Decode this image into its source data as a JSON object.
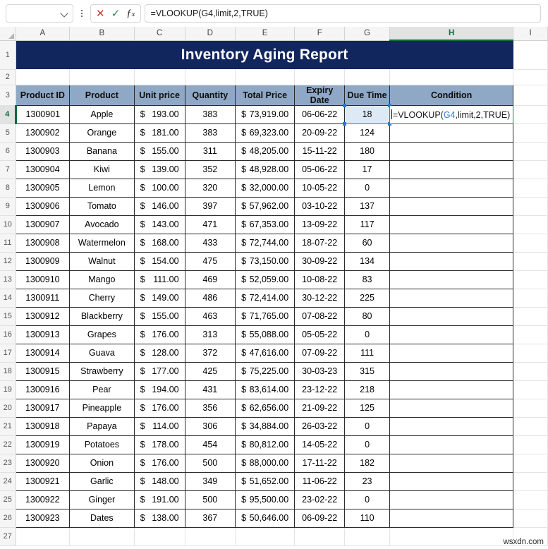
{
  "formula_bar": {
    "name_box_value": "",
    "name_box_placeholder": "",
    "cancel_icon": "cancel-x-icon",
    "confirm_icon": "confirm-check-icon",
    "function_icon": "insert-function-fx-icon",
    "formula_value": "=VLOOKUP(G4,limit,2,TRUE)"
  },
  "grid": {
    "column_headers": [
      "A",
      "B",
      "C",
      "D",
      "E",
      "F",
      "G",
      "H",
      "I"
    ],
    "selected_column": "H",
    "row_headers": [
      "1",
      "2",
      "3",
      "4",
      "5",
      "6",
      "7",
      "8",
      "9",
      "10",
      "11",
      "12",
      "13",
      "14",
      "15",
      "16",
      "17",
      "18",
      "19",
      "20",
      "21",
      "22",
      "23",
      "24",
      "25",
      "26",
      "27"
    ],
    "selected_row": "4"
  },
  "title": {
    "text": "Inventory Aging Report",
    "background": "#12265E",
    "color": "#FFFFFF",
    "range": "A1:H1"
  },
  "table": {
    "header_background": "#8FA8C6",
    "headers": [
      "Product ID",
      "Product",
      "Unit price",
      "Quantity",
      "Total Price",
      "Expiry Date",
      "Due Time",
      "Condition"
    ],
    "rows": [
      {
        "row": "4",
        "product_id": "1300901",
        "product": "Apple",
        "unit_price": "193.00",
        "quantity": "383",
        "total_price": "73,919.00",
        "expiry_date": "06-06-22",
        "due_time": "18",
        "condition": ""
      },
      {
        "row": "5",
        "product_id": "1300902",
        "product": "Orange",
        "unit_price": "181.00",
        "quantity": "383",
        "total_price": "69,323.00",
        "expiry_date": "20-09-22",
        "due_time": "124",
        "condition": ""
      },
      {
        "row": "6",
        "product_id": "1300903",
        "product": "Banana",
        "unit_price": "155.00",
        "quantity": "311",
        "total_price": "48,205.00",
        "expiry_date": "15-11-22",
        "due_time": "180",
        "condition": ""
      },
      {
        "row": "7",
        "product_id": "1300904",
        "product": "Kiwi",
        "unit_price": "139.00",
        "quantity": "352",
        "total_price": "48,928.00",
        "expiry_date": "05-06-22",
        "due_time": "17",
        "condition": ""
      },
      {
        "row": "8",
        "product_id": "1300905",
        "product": "Lemon",
        "unit_price": "100.00",
        "quantity": "320",
        "total_price": "32,000.00",
        "expiry_date": "10-05-22",
        "due_time": "0",
        "condition": ""
      },
      {
        "row": "9",
        "product_id": "1300906",
        "product": "Tomato",
        "unit_price": "146.00",
        "quantity": "397",
        "total_price": "57,962.00",
        "expiry_date": "03-10-22",
        "due_time": "137",
        "condition": ""
      },
      {
        "row": "10",
        "product_id": "1300907",
        "product": "Avocado",
        "unit_price": "143.00",
        "quantity": "471",
        "total_price": "67,353.00",
        "expiry_date": "13-09-22",
        "due_time": "117",
        "condition": ""
      },
      {
        "row": "11",
        "product_id": "1300908",
        "product": "Watermelon",
        "unit_price": "168.00",
        "quantity": "433",
        "total_price": "72,744.00",
        "expiry_date": "18-07-22",
        "due_time": "60",
        "condition": ""
      },
      {
        "row": "12",
        "product_id": "1300909",
        "product": "Walnut",
        "unit_price": "154.00",
        "quantity": "475",
        "total_price": "73,150.00",
        "expiry_date": "30-09-22",
        "due_time": "134",
        "condition": ""
      },
      {
        "row": "13",
        "product_id": "1300910",
        "product": "Mango",
        "unit_price": "111.00",
        "quantity": "469",
        "total_price": "52,059.00",
        "expiry_date": "10-08-22",
        "due_time": "83",
        "condition": ""
      },
      {
        "row": "14",
        "product_id": "1300911",
        "product": "Cherry",
        "unit_price": "149.00",
        "quantity": "486",
        "total_price": "72,414.00",
        "expiry_date": "30-12-22",
        "due_time": "225",
        "condition": ""
      },
      {
        "row": "15",
        "product_id": "1300912",
        "product": "Blackberry",
        "unit_price": "155.00",
        "quantity": "463",
        "total_price": "71,765.00",
        "expiry_date": "07-08-22",
        "due_time": "80",
        "condition": ""
      },
      {
        "row": "16",
        "product_id": "1300913",
        "product": "Grapes",
        "unit_price": "176.00",
        "quantity": "313",
        "total_price": "55,088.00",
        "expiry_date": "05-05-22",
        "due_time": "0",
        "condition": ""
      },
      {
        "row": "17",
        "product_id": "1300914",
        "product": "Guava",
        "unit_price": "128.00",
        "quantity": "372",
        "total_price": "47,616.00",
        "expiry_date": "07-09-22",
        "due_time": "111",
        "condition": ""
      },
      {
        "row": "18",
        "product_id": "1300915",
        "product": "Strawberry",
        "unit_price": "177.00",
        "quantity": "425",
        "total_price": "75,225.00",
        "expiry_date": "30-03-23",
        "due_time": "315",
        "condition": ""
      },
      {
        "row": "19",
        "product_id": "1300916",
        "product": "Pear",
        "unit_price": "194.00",
        "quantity": "431",
        "total_price": "83,614.00",
        "expiry_date": "23-12-22",
        "due_time": "218",
        "condition": ""
      },
      {
        "row": "20",
        "product_id": "1300917",
        "product": "Pineapple",
        "unit_price": "176.00",
        "quantity": "356",
        "total_price": "62,656.00",
        "expiry_date": "21-09-22",
        "due_time": "125",
        "condition": ""
      },
      {
        "row": "21",
        "product_id": "1300918",
        "product": "Papaya",
        "unit_price": "114.00",
        "quantity": "306",
        "total_price": "34,884.00",
        "expiry_date": "26-03-22",
        "due_time": "0",
        "condition": ""
      },
      {
        "row": "22",
        "product_id": "1300919",
        "product": "Potatoes",
        "unit_price": "178.00",
        "quantity": "454",
        "total_price": "80,812.00",
        "expiry_date": "14-05-22",
        "due_time": "0",
        "condition": ""
      },
      {
        "row": "23",
        "product_id": "1300920",
        "product": "Onion",
        "unit_price": "176.00",
        "quantity": "500",
        "total_price": "88,000.00",
        "expiry_date": "17-11-22",
        "due_time": "182",
        "condition": ""
      },
      {
        "row": "24",
        "product_id": "1300921",
        "product": "Garlic",
        "unit_price": "148.00",
        "quantity": "349",
        "total_price": "51,652.00",
        "expiry_date": "11-06-22",
        "due_time": "23",
        "condition": ""
      },
      {
        "row": "25",
        "product_id": "1300922",
        "product": "Ginger",
        "unit_price": "191.00",
        "quantity": "500",
        "total_price": "95,500.00",
        "expiry_date": "23-02-22",
        "due_time": "0",
        "condition": ""
      },
      {
        "row": "26",
        "product_id": "1300923",
        "product": "Dates",
        "unit_price": "138.00",
        "quantity": "367",
        "total_price": "50,646.00",
        "expiry_date": "06-09-22",
        "due_time": "110",
        "condition": ""
      }
    ],
    "currency_symbol": "$"
  },
  "active_cell": {
    "address": "H4",
    "editing_text_prefix": "=VLOOKUP(",
    "editing_text_ref": "G4",
    "editing_text_suffix": ",limit,2,TRUE)",
    "border_color": "#217346"
  },
  "referenced_cell": {
    "address": "G4",
    "value": "18",
    "highlight_color": "#2B7CD3",
    "fill_color": "#DDEAF6"
  },
  "watermark": {
    "text": "wsxdn.com"
  }
}
